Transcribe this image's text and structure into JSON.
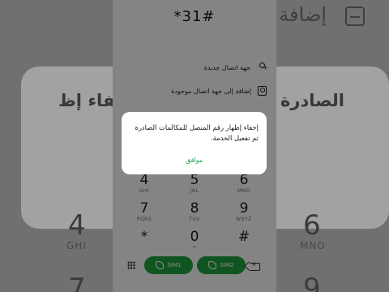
{
  "dialer": {
    "number": "*31#",
    "actions": [
      {
        "label": "جهة اتصال جديدة",
        "icon": "person-add-icon"
      },
      {
        "label": "إضافة إلى جهة اتصال موجودة",
        "icon": "contact-card-icon"
      }
    ],
    "keys": [
      {
        "digit": "4",
        "letters": "GHI"
      },
      {
        "digit": "5",
        "letters": "JKL"
      },
      {
        "digit": "6",
        "letters": "MNO"
      },
      {
        "digit": "7",
        "letters": "PQRS"
      },
      {
        "digit": "8",
        "letters": "TUV"
      },
      {
        "digit": "9",
        "letters": "WXYZ"
      },
      {
        "digit": "*",
        "letters": ""
      },
      {
        "digit": "0",
        "letters": "+"
      },
      {
        "digit": "#",
        "letters": ""
      }
    ],
    "call_buttons": [
      {
        "label": "SIM1"
      },
      {
        "label": "SIM2"
      }
    ]
  },
  "dialog": {
    "message": "إخفاء إظهار رقم المتصل للمكالمات الصادرة تم تفعيل الخدمة.",
    "ok_label": "موافق"
  },
  "background": {
    "add_contact_large": "إضافة إ",
    "title_large": "إخفاء إظ",
    "title_large_right": "الصادرة",
    "digits": [
      {
        "digit": "4",
        "letters": "GHI"
      },
      {
        "digit": "6",
        "letters": "MNO"
      },
      {
        "digit": "7",
        "letters": ""
      },
      {
        "digit": "9",
        "letters": ""
      }
    ]
  }
}
